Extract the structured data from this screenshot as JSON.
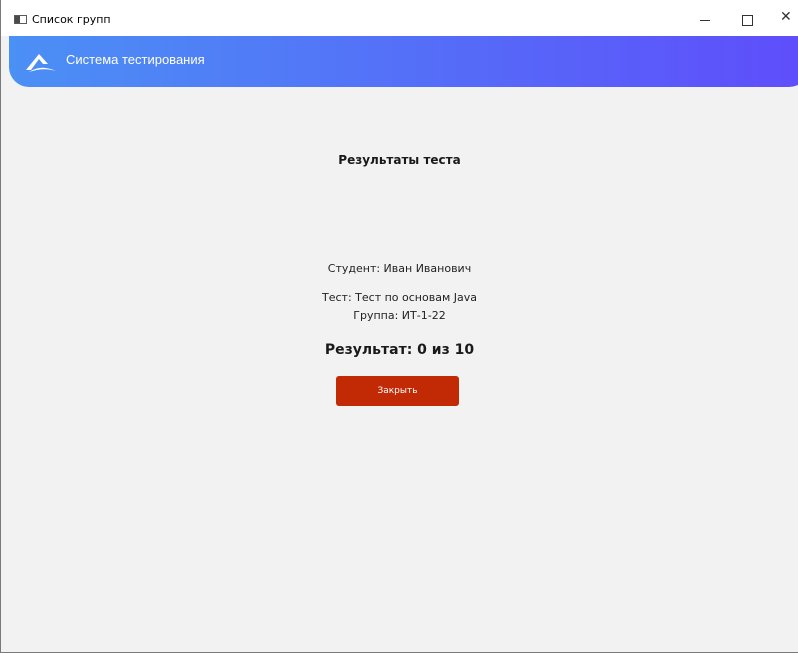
{
  "window": {
    "title": "Список групп"
  },
  "header": {
    "title": "Система тестирования",
    "gradient_start": "#4b90f5",
    "gradient_end": "#5f4dfb"
  },
  "results": {
    "title": "Результаты теста",
    "student": "Студент: Иван Иванович",
    "test": "Тест: Тест по основам Java",
    "group": "Группа: ИТ-1-22",
    "score": "Результат: 0 из 10",
    "close_label": "Закрыть",
    "close_color": "#c12a04"
  }
}
